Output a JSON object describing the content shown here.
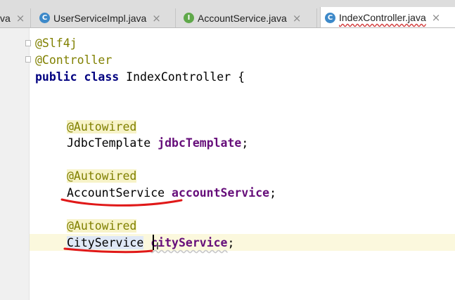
{
  "tabs": [
    {
      "label": "va",
      "icon": "none",
      "active": false
    },
    {
      "label": "UserServiceImpl.java",
      "icon": "class-icon",
      "icon_text": "C",
      "active": false
    },
    {
      "label": "AccountService.java",
      "icon": "interface-icon",
      "icon_text": "I",
      "active": false
    },
    {
      "label": "IndexController.java",
      "icon": "class-icon",
      "icon_text": "C",
      "active": true
    }
  ],
  "close_glyph": "×",
  "code": {
    "line1": "@Slf4j",
    "line2": "@Controller",
    "line3_kw": "public class",
    "line3_rest": " IndexController {",
    "ann1": "@Autowired",
    "type1": "JdbcTemplate",
    "var1": "jdbcTemplate",
    "ann2": "@Autowired",
    "type2": "AccountService",
    "var2": "accountService",
    "ann3": "@Autowired",
    "type3": "CityService",
    "var3": "cityService",
    "semicolon": ";"
  },
  "cursor_glyph": "I",
  "colors": {
    "annotation": "#808000",
    "keyword": "#000080",
    "field": "#660e7a",
    "red_marker": "#e01818",
    "caret_line": "#fbf8dd"
  }
}
